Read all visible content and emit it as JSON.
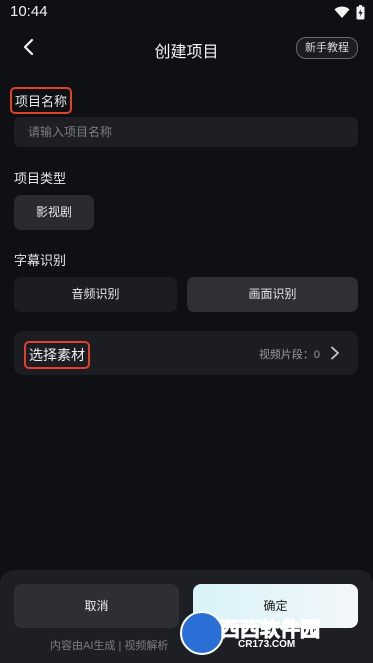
{
  "status_bar": {
    "time": "10:44",
    "icons": [
      "wifi-icon",
      "battery-icon"
    ]
  },
  "header": {
    "title": "创建项目",
    "tutorial_label": "新手教程",
    "back_icon": "back-arrow-icon"
  },
  "project_name": {
    "label": "项目名称",
    "placeholder": "请输入项目名称"
  },
  "project_type": {
    "label": "项目类型",
    "option": "影视剧"
  },
  "subtitle_recognition": {
    "label": "字幕识别",
    "options": [
      "音频识别",
      "画面识别"
    ]
  },
  "material": {
    "title": "选择素材",
    "count_text": "视频片段：0",
    "chevron_icon": "chevron-right-icon"
  },
  "footer": {
    "cancel_label": "取消",
    "confirm_label": "确定",
    "disclaimer": "内容由AI生成 | 视频解析"
  },
  "watermark": {
    "text": "西西软件园",
    "sub": "CR173.COM"
  },
  "colors": {
    "background": "#0f1014",
    "highlight": "#e0402c",
    "selected_segment": "#2f3036",
    "confirm_gradient_start": "#d8f3f8"
  }
}
